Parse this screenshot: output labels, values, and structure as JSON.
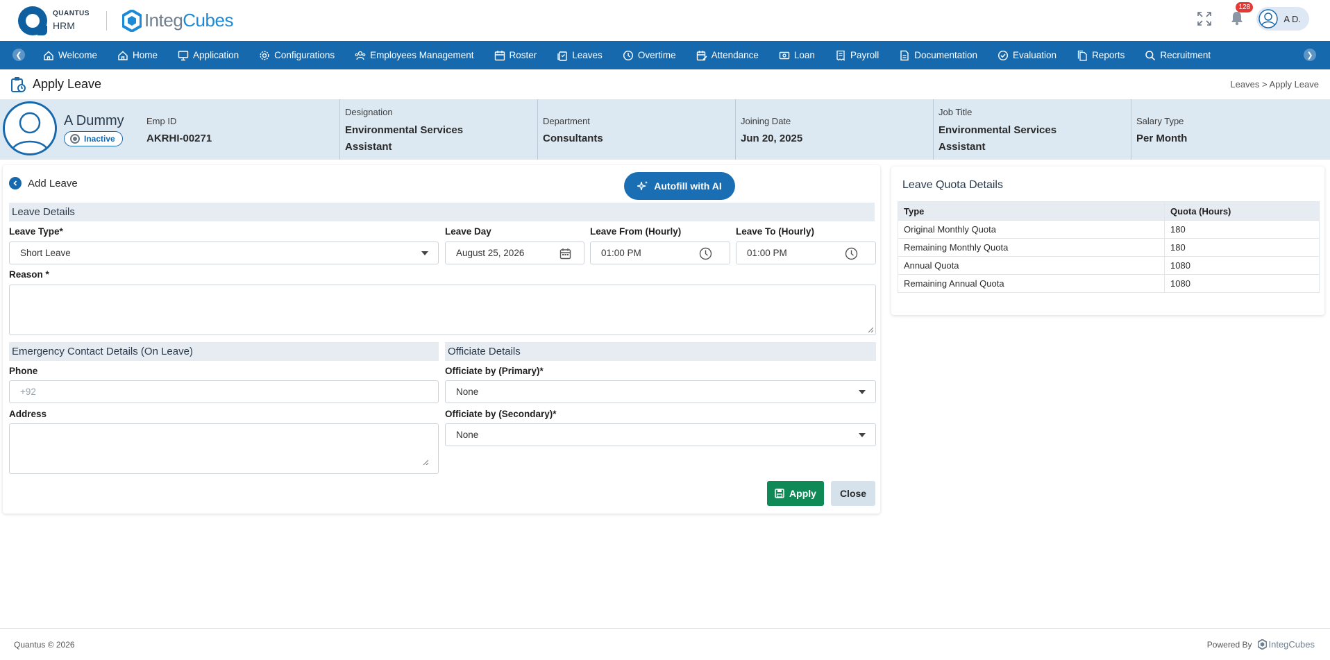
{
  "brand": {
    "line1": "QUANTUS",
    "line2": "HRM",
    "partner_left": "Integ",
    "partner_right": "Cubes"
  },
  "header": {
    "notification_count": "128",
    "user_initials": "A D."
  },
  "nav": {
    "items": [
      {
        "label": "Welcome",
        "icon": "home-icon"
      },
      {
        "label": "Home",
        "icon": "home-icon"
      },
      {
        "label": "Application",
        "icon": "monitor-icon"
      },
      {
        "label": "Configurations",
        "icon": "gear-icon"
      },
      {
        "label": "Employees Management",
        "icon": "users-icon"
      },
      {
        "label": "Roster",
        "icon": "calendar-icon"
      },
      {
        "label": "Leaves",
        "icon": "clipboard-icon"
      },
      {
        "label": "Overtime",
        "icon": "clock-icon"
      },
      {
        "label": "Attendance",
        "icon": "calendar-edit-icon"
      },
      {
        "label": "Loan",
        "icon": "cash-icon"
      },
      {
        "label": "Payroll",
        "icon": "receipt-icon"
      },
      {
        "label": "Documentation",
        "icon": "document-icon"
      },
      {
        "label": "Evaluation",
        "icon": "check-circle-icon"
      },
      {
        "label": "Reports",
        "icon": "files-icon"
      },
      {
        "label": "Recruitment",
        "icon": "search-icon"
      }
    ]
  },
  "page": {
    "title": "Apply Leave",
    "breadcrumb": "Leaves > Apply Leave"
  },
  "employee": {
    "name": "A Dummy",
    "status": "Inactive",
    "emp_id_label": "Emp ID",
    "emp_id": "AKRHI-00271",
    "designation_label": "Designation",
    "designation_line1": "Environmental Services",
    "designation_line2": "Assistant",
    "department_label": "Department",
    "department": "Consultants",
    "joining_label": "Joining Date",
    "joining": "Jun 20, 2025",
    "job_title_label": "Job Title",
    "job_title_line1": "Environmental Services",
    "job_title_line2": "Assistant",
    "salary_type_label": "Salary Type",
    "salary_type": "Per Month"
  },
  "form": {
    "heading": "Add Leave",
    "autofill_label": "Autofill with AI",
    "leave_details_heading": "Leave Details",
    "leave_type_label": "Leave Type*",
    "leave_type_value": "Short Leave",
    "leave_day_label": "Leave Day",
    "leave_day_value": "August 25, 2026",
    "leave_from_label": "Leave From (Hourly)",
    "leave_from_value": "01:00 PM",
    "leave_to_label": "Leave To (Hourly)",
    "leave_to_value": "01:00 PM",
    "reason_label": "Reason *",
    "reason_value": "",
    "emergency_heading": "Emergency Contact Details (On Leave)",
    "phone_label": "Phone",
    "phone_placeholder": "+92",
    "address_label": "Address",
    "officiate_heading": "Officiate Details",
    "officiate_primary_label": "Officiate by (Primary)*",
    "officiate_primary_value": "None",
    "officiate_secondary_label": "Officiate by (Secondary)*",
    "officiate_secondary_value": "None",
    "apply_label": "Apply",
    "close_label": "Close"
  },
  "quota": {
    "title": "Leave Quota Details",
    "headers": [
      "Type",
      "Quota (Hours)"
    ],
    "rows": [
      [
        "Original Monthly Quota",
        "180"
      ],
      [
        "Remaining Monthly Quota",
        "180"
      ],
      [
        "Annual Quota",
        "1080"
      ],
      [
        "Remaining Annual Quota",
        "1080"
      ]
    ]
  },
  "footer": {
    "copyright": "Quantus © 2026",
    "powered_by": "Powered By",
    "powered_brand": "IntegCubes"
  },
  "colors": {
    "primary": "#1769ae",
    "apply": "#0f8a56",
    "banner": "#dce9f2",
    "badge": "#e53935"
  }
}
